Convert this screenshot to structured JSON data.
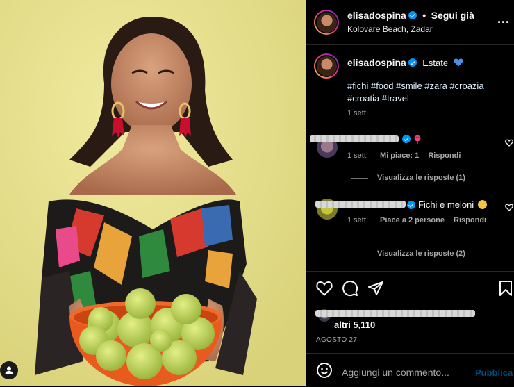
{
  "post_header": {
    "username": "elisadospina",
    "follow_separator": "•",
    "follow_label": "Segui già",
    "location": "Kolovare Beach, Zadar",
    "more_label": "..."
  },
  "caption": {
    "username": "elisadospina",
    "text": "Estate",
    "hashtags_line1": "#fichi #food #smile #zara #croazia",
    "hashtags_line2": "#croatia #travel",
    "time": "1 sett."
  },
  "comments": [
    {
      "text": "",
      "time": "1 sett.",
      "likes": "Mi piace: 1",
      "reply": "Rispondi",
      "view_replies": "Visualizza le risposte (1)"
    },
    {
      "text": "Fichi e meloni",
      "time": "1 sett.",
      "likes": "Piace a 2 persone",
      "reply": "Rispondi",
      "view_replies": "Visualizza le risposte (2)"
    }
  ],
  "likes": {
    "others": "altri 5,110",
    "date": "AGOSTO 27"
  },
  "comment_input": {
    "placeholder": "Aggiungi un commento...",
    "publish": "Pubblica"
  },
  "colors": {
    "background": "#000000",
    "accent_blue": "#0095f6",
    "muted_text": "#a8a8a8",
    "divider": "#262626",
    "photo_wall": "#e9e28f"
  },
  "icons": [
    "user-tag-icon",
    "verified-icon",
    "more-options-icon",
    "heart-icon",
    "comment-icon",
    "share-icon",
    "save-icon",
    "emoji-icon",
    "blue-heart-icon",
    "rose-emoji-icon"
  ]
}
